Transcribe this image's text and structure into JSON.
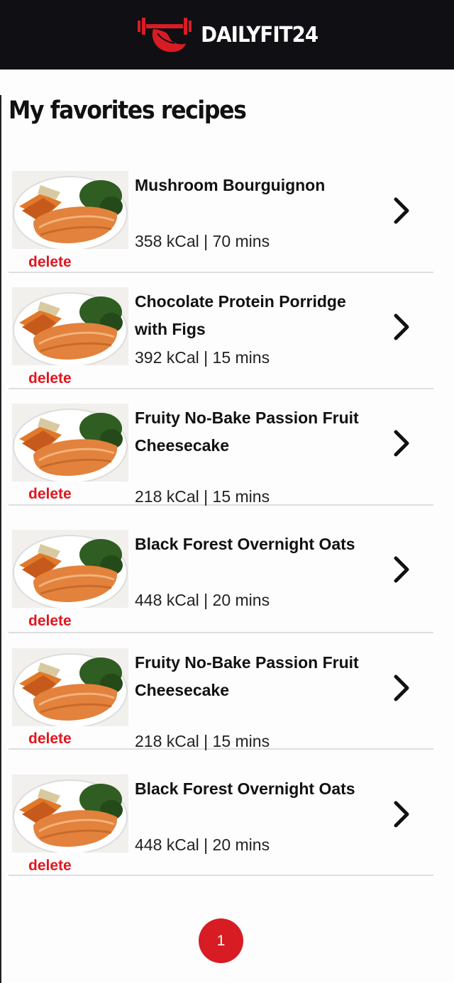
{
  "header": {
    "brand": "DAILYFIT24"
  },
  "page": {
    "title": "My favorites recipes"
  },
  "recipes": [
    {
      "name": "Mushroom Bourguignon",
      "meta": "358 kCal | 70 mins",
      "delete_label": "delete"
    },
    {
      "name": "Chocolate Protein Porridge with Figs",
      "meta": "392 kCal | 15 mins",
      "delete_label": "delete"
    },
    {
      "name": "Fruity No-Bake Passion Fruit Cheesecake",
      "meta": "218 kCal | 15 mins",
      "delete_label": "delete"
    },
    {
      "name": "Black Forest Overnight Oats",
      "meta": "448 kCal | 20 mins",
      "delete_label": "delete"
    },
    {
      "name": "Fruity No-Bake Passion Fruit Cheesecake",
      "meta": "218 kCal | 15 mins",
      "delete_label": "delete"
    },
    {
      "name": "Black Forest Overnight Oats",
      "meta": "448 kCal | 20 mins",
      "delete_label": "delete"
    }
  ],
  "pagination": {
    "current": "1"
  },
  "colors": {
    "header_bg": "#0f0f14",
    "accent": "#e0161f",
    "pagination_bg": "#d71c24"
  },
  "icons": {
    "logo": "dumbbell-muscle-logo",
    "chevron": "chevron-right-icon",
    "thumbnail": "salmon-plate-image"
  }
}
